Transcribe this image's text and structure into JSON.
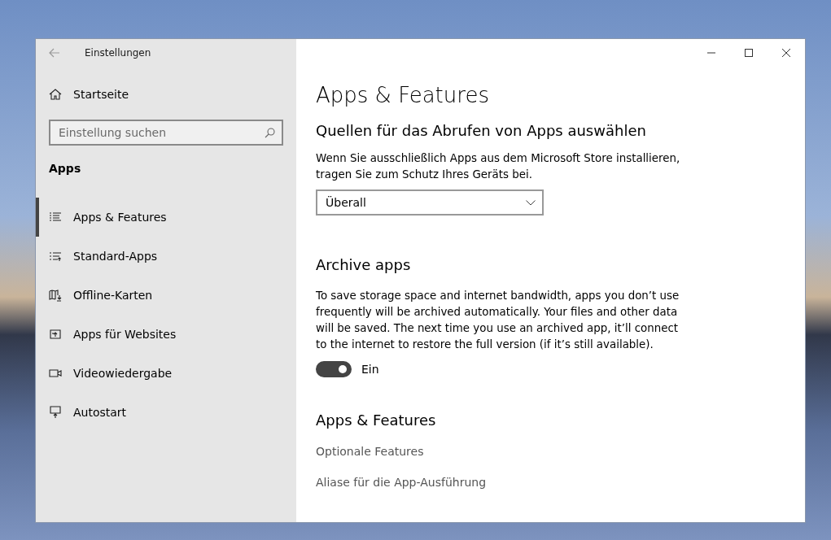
{
  "window": {
    "title": "Einstellungen"
  },
  "sidebar": {
    "home": "Startseite",
    "search": {
      "placeholder": "Einstellung suchen"
    },
    "section": "Apps",
    "items": [
      {
        "label": "Apps & Features",
        "kind": "list",
        "selected": true
      },
      {
        "label": "Standard-Apps",
        "kind": "defaults",
        "selected": false
      },
      {
        "label": "Offline-Karten",
        "kind": "map",
        "selected": false
      },
      {
        "label": "Apps für Websites",
        "kind": "web",
        "selected": false
      },
      {
        "label": "Videowiedergabe",
        "kind": "video",
        "selected": false
      },
      {
        "label": "Autostart",
        "kind": "startup",
        "selected": false
      }
    ]
  },
  "content": {
    "title": "Apps & Features",
    "sources": {
      "heading": "Quellen für das Abrufen von Apps auswählen",
      "text": "Wenn Sie ausschließlich Apps aus dem Microsoft Store installieren, tragen Sie zum Schutz Ihres Geräts bei.",
      "dropdown": "Überall"
    },
    "archive": {
      "heading": "Archive apps",
      "text": "To save storage space and internet bandwidth, apps you don’t use frequently will be archived automatically. Your files and other data will be saved. The next time you use an archived app, it’ll connect to the internet to restore the full version (if it’s still available).",
      "toggle": {
        "on": true,
        "label": "Ein"
      }
    },
    "related": {
      "heading": "Apps & Features",
      "links": [
        "Optionale Features",
        "Aliase für die App-Ausführung"
      ]
    }
  }
}
